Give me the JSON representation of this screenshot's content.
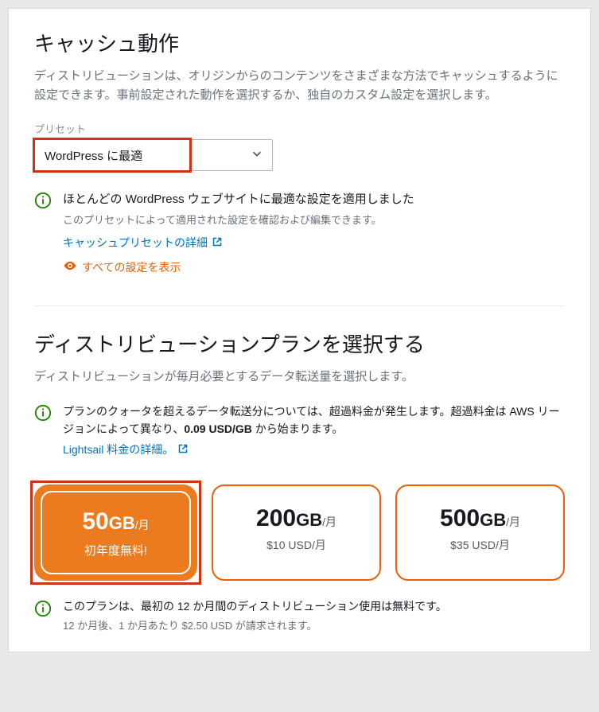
{
  "cache": {
    "title": "キャッシュ動作",
    "desc": "ディストリビューションは、オリジンからのコンテンツをさまざまな方法でキャッシュするように設定できます。事前設定された動作を選択するか、独自のカスタム設定を選択します。",
    "preset_label": "プリセット",
    "preset_value": "WordPress に最適",
    "info_title": "ほとんどの WordPress ウェブサイトに最適な設定を適用しました",
    "info_sub": "このプリセットによって適用された設定を確認および編集できます。",
    "detail_link": "キャッシュプリセットの詳細",
    "show_all": "すべての設定を表示"
  },
  "plan": {
    "title": "ディストリビューションプランを選択する",
    "desc": "ディストリビューションが毎月必要とするデータ転送量を選択します。",
    "quota_text1": "プランのクォータを超えるデータ転送分については、超過料金が発生します。超過料金は AWS リージョンによって異なり、",
    "quota_bold": "0.09 USD/GB",
    "quota_text2": " から始まります。",
    "pricing_link": "Lightsail 料金の詳細。",
    "options": [
      {
        "amount": "50",
        "unit": "GB",
        "per": "/月",
        "price": "初年度無料!"
      },
      {
        "amount": "200",
        "unit": "GB",
        "per": "/月",
        "price": "$10 USD/月"
      },
      {
        "amount": "500",
        "unit": "GB",
        "per": "/月",
        "price": "$35 USD/月"
      }
    ],
    "footer_title": "このプランは、最初の 12 か月間のディストリビューション使用は無料です。",
    "footer_sub": "12 か月後、1 か月あたり $2.50 USD が請求されます。"
  }
}
